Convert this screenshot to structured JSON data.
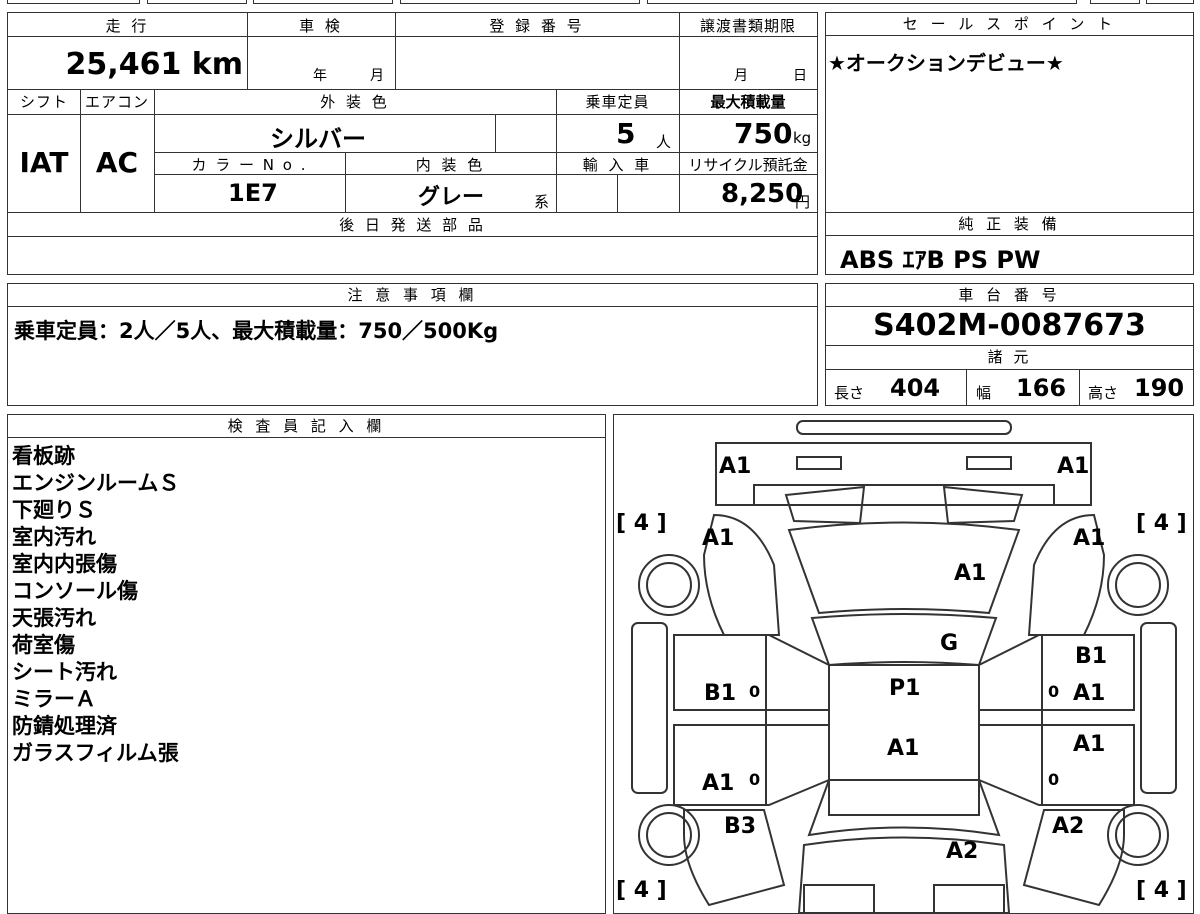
{
  "sheet": {
    "mileage": {
      "label": "走 行",
      "value": "25,461",
      "unit": "km"
    },
    "inspection": {
      "label": "車 検",
      "year": "年",
      "month": "月"
    },
    "registration": {
      "label": "登 録 番 号",
      "value": ""
    },
    "transfer_deadline": {
      "label": "譲渡書類期限",
      "month": "月",
      "day": "日"
    },
    "shift": {
      "label": "シフト",
      "value": "IAT"
    },
    "aircon": {
      "label": "エアコン",
      "value": "AC"
    },
    "exterior_color": {
      "label": "外 装 色",
      "value": "シルバー"
    },
    "capacity": {
      "label": "乗車定員",
      "value": "5",
      "unit": "人"
    },
    "max_load": {
      "label": "最大積載量",
      "value": "750",
      "unit": "kg"
    },
    "color_no": {
      "label": "カ ラ ー N o .",
      "value": "1E7"
    },
    "interior_color": {
      "label": "内 装 色",
      "value": "グレー",
      "suffix": "系"
    },
    "imported": {
      "label": "輸 入 車",
      "value": ""
    },
    "recycle": {
      "label": "リサイクル預託金",
      "value": "8,250",
      "unit": "円"
    },
    "later_parts": {
      "label": "後 日 発 送 部 品",
      "value": ""
    },
    "notes": {
      "label": "注 意 事 項 欄",
      "value": "乗車定員：2人／5人、最大積載量：750／500Kg"
    },
    "inspector": {
      "label": "検 査 員 記 入 欄",
      "items": [
        "看板跡",
        "エンジンルームＳ",
        "下廻りＳ",
        "室内汚れ",
        "室内内張傷",
        "コンソール傷",
        "天張汚れ",
        "荷室傷",
        "シート汚れ",
        "ミラーＡ",
        "防錆処理済",
        "ガラスフィルム張"
      ]
    }
  },
  "sales_point": {
    "label": "セ ー ル ス ポ イ ン ト",
    "value": "★オークションデビュー★"
  },
  "equipment": {
    "label": "純 正 装 備",
    "value": "ABS ｴｱB PS PW"
  },
  "chassis": {
    "label": "車 台 番 号",
    "value": "S402M-0087673"
  },
  "specs": {
    "label": "諸 元",
    "length": {
      "label": "長さ",
      "value": "404"
    },
    "width": {
      "label": "幅",
      "value": "166"
    },
    "height": {
      "label": "高さ",
      "value": "190"
    }
  },
  "diagram": {
    "tires": [
      "[ 4 ]",
      "[ 4 ]",
      "[ 4 ]",
      "[ 4 ]"
    ],
    "marks": [
      "A1",
      "A1",
      "A1",
      "A1",
      "A1",
      "G",
      "B1",
      "B1",
      "A1",
      "P1",
      "A1",
      "A1",
      "A1",
      "B3",
      "A2",
      "A2"
    ],
    "zeros": [
      "0",
      "0",
      "0",
      "0"
    ]
  },
  "colors": {
    "line": "#333333",
    "background": "#ffffff",
    "text": "#000000"
  }
}
